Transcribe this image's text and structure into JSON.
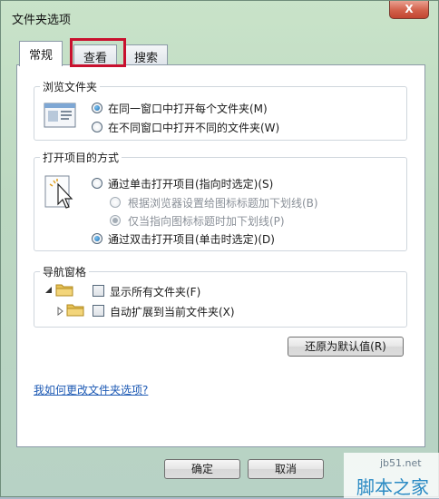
{
  "window": {
    "title": "文件夹选项",
    "close_label": "X"
  },
  "tabs": [
    {
      "label": "常规",
      "active": true
    },
    {
      "label": "查看",
      "active": false
    },
    {
      "label": "搜索",
      "active": false
    }
  ],
  "browse_group": {
    "label": "浏览文件夹",
    "options": [
      {
        "label": "在同一窗口中打开每个文件夹(M)",
        "checked": true
      },
      {
        "label": "在不同窗口中打开不同的文件夹(W)",
        "checked": false
      }
    ]
  },
  "click_group": {
    "label": "打开项目的方式",
    "options": [
      {
        "label": "通过单击打开项目(指向时选定)(S)",
        "checked": false
      },
      {
        "label": "根据浏览器设置给图标标题加下划线(B)",
        "checked": false,
        "disabled": true
      },
      {
        "label": "仅当指向图标标题时加下划线(P)",
        "checked": true,
        "disabled": true
      },
      {
        "label": "通过双击打开项目(单击时选定)(D)",
        "checked": true
      }
    ]
  },
  "nav_group": {
    "label": "导航窗格",
    "items": [
      {
        "label": "显示所有文件夹(F)",
        "checked": false
      },
      {
        "label": "自动扩展到当前文件夹(X)",
        "checked": false
      }
    ]
  },
  "restore_button": "还原为默认值(R)",
  "help_link": "我如何更改文件夹选项?",
  "ok_button": "确定",
  "cancel_button": "取消",
  "watermark": {
    "url": "jb51.net",
    "text": "脚本之家"
  }
}
